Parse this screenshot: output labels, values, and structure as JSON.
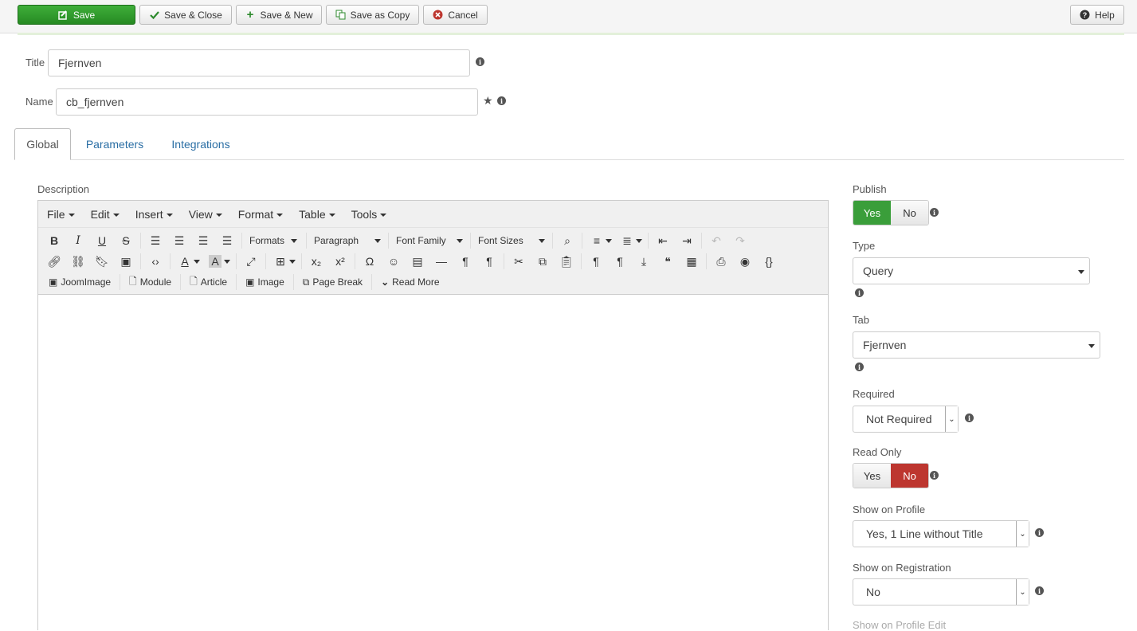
{
  "toolbar": {
    "save": "Save",
    "save_close": "Save & Close",
    "save_new": "Save & New",
    "save_copy": "Save as Copy",
    "cancel": "Cancel",
    "help": "Help"
  },
  "form": {
    "title_label": "Title",
    "title_value": "Fjernven",
    "name_label": "Name",
    "name_value": "cb_fjernven"
  },
  "tabs": [
    "Global",
    "Parameters",
    "Integrations"
  ],
  "description_label": "Description",
  "editor": {
    "menus": [
      "File",
      "Edit",
      "Insert",
      "View",
      "Format",
      "Table",
      "Tools"
    ],
    "formats": "Formats",
    "block": "Paragraph",
    "font_family": "Font Family",
    "font_sizes": "Font Sizes",
    "insert_buttons": [
      "JoomImage",
      "Module",
      "Article",
      "Image",
      "Page Break",
      "Read More"
    ]
  },
  "right": {
    "publish_label": "Publish",
    "publish_yes": "Yes",
    "publish_no": "No",
    "type_label": "Type",
    "type_value": "Query",
    "tab_label": "Tab",
    "tab_value": "Fjernven",
    "required_label": "Required",
    "required_value": "Not Required",
    "readonly_label": "Read Only",
    "readonly_yes": "Yes",
    "readonly_no": "No",
    "show_profile_label": "Show on Profile",
    "show_profile_value": "Yes, 1 Line without Title",
    "show_reg_label": "Show on Registration",
    "show_reg_value": "No",
    "show_profile_edit_label": "Show on Profile Edit"
  },
  "colors": {
    "green": "#3a9e3a",
    "red": "#bd362f",
    "link": "#2a6ea4"
  }
}
